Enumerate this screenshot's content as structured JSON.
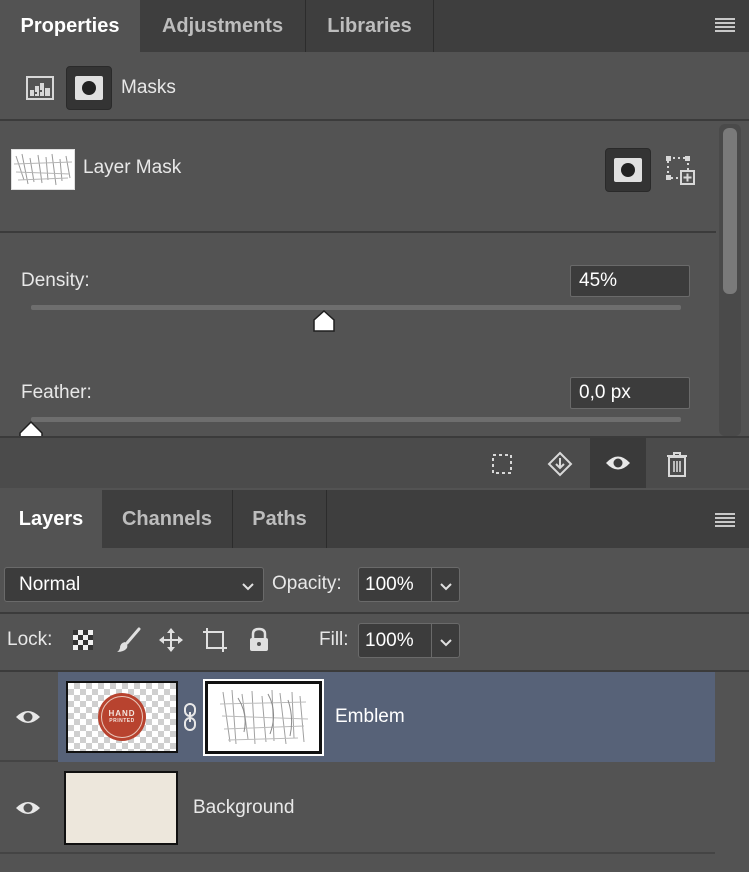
{
  "properties_panel": {
    "tabs": [
      {
        "label": "Properties",
        "active": true
      },
      {
        "label": "Adjustments",
        "active": false
      },
      {
        "label": "Libraries",
        "active": false
      }
    ],
    "section_label": "Masks",
    "layer_mask_label": "Layer Mask",
    "density": {
      "label": "Density:",
      "value": "45%",
      "slider_level": 0.45
    },
    "feather": {
      "label": "Feather:",
      "value": "0,0 px",
      "slider_level": 0.0
    }
  },
  "layers_panel": {
    "tabs": [
      {
        "label": "Layers",
        "active": true
      },
      {
        "label": "Channels",
        "active": false
      },
      {
        "label": "Paths",
        "active": false
      }
    ],
    "blend_mode": "Normal",
    "opacity_label": "Opacity:",
    "opacity_value": "100%",
    "lock_label": "Lock:",
    "fill_label": "Fill:",
    "fill_value": "100%",
    "layers": [
      {
        "name": "Emblem",
        "selected": true,
        "emblem_line1": "HAND",
        "emblem_line2": "PRINTED"
      },
      {
        "name": "Background",
        "selected": false
      }
    ]
  },
  "colors": {
    "panel_bg": "#535353",
    "tab_bar_bg": "#3e3e3e",
    "selected_layer_bg": "#576278",
    "emblem_red": "#b8432f",
    "background_fill": "#ede7dc"
  }
}
